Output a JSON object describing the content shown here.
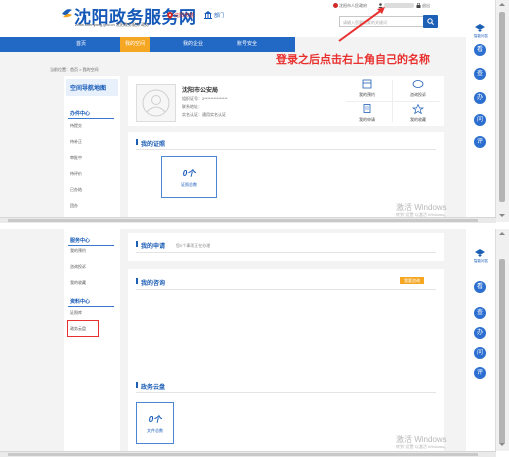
{
  "header": {
    "site_title": "沈阳政务服务网",
    "site_subtitle": "zwfw.shenyang.gov.cn  沈阳政务服务 政务",
    "location_label": "沈阳市辖",
    "dept_label": "部门",
    "top_link_1": "沈阳市人民政府",
    "top_link_2": "退出",
    "search_placeholder": "请输入您要搜索的关键词"
  },
  "nav": {
    "items": [
      "首页",
      "我的空间",
      "我的企业",
      "账号安全"
    ]
  },
  "annotation": "登录之后点击右上角自己的名称",
  "breadcrumb": "当前位置：首页 > 我的空间",
  "sidebar_top": {
    "banner": "空间导航地图",
    "heading": "办件中心",
    "items": [
      "待提交",
      "待补正",
      "审批中",
      "待评价",
      "已办结",
      "团办"
    ]
  },
  "profile": {
    "org_name": "沈阳市公安局",
    "id_line": "组织证号：2***************",
    "contact_line": "联系地址：",
    "verify_line": "实名认证：通用实名认证"
  },
  "quick_actions": [
    "我的预约",
    "咨询投诉",
    "我的申请",
    "我的收藏"
  ],
  "cloud_top": {
    "title": "我的证照",
    "count": "0个",
    "label": "证照总数"
  },
  "sidebar_bottom": {
    "heading1": "服务中心",
    "items1": [
      "我的预约",
      "咨询投诉",
      "我的收藏"
    ],
    "heading2": "资料中心",
    "items2": [
      "证照库",
      "政务云盘"
    ]
  },
  "apply": {
    "title": "我的申请",
    "note": "您0个事项正在办理"
  },
  "consult": {
    "title": "我的咨询",
    "button": "我要咨询"
  },
  "cloud_bottom": {
    "title": "政务云盘",
    "count": "0个",
    "label": "文件总数"
  },
  "right_rail": {
    "top_label": "智能问答",
    "circles": [
      "看",
      "查",
      "办",
      "问",
      "评"
    ]
  },
  "watermark": {
    "line1": "激活 Windows",
    "line2": "转到\"设置\"以激活 Windows。"
  },
  "colors": {
    "brand_blue": "#2268c5",
    "accent_orange": "#f5a623",
    "annotation_red": "#e8302e"
  }
}
